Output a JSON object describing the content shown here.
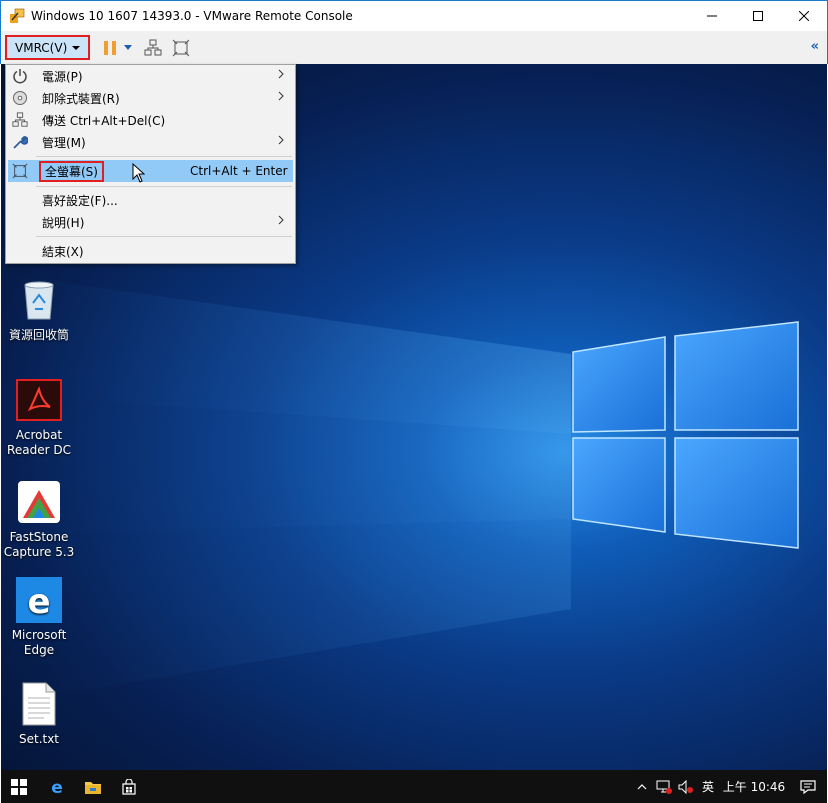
{
  "window": {
    "title": "Windows 10 1607 14393.0 - VMware Remote Console",
    "minimize_glyph": "—",
    "maximize_glyph": "☐",
    "close_glyph": "✕"
  },
  "toolbar": {
    "vmrc_label": "VMRC(V)",
    "collapse_glyph": "«"
  },
  "menu": {
    "items": [
      {
        "label": "電源(P)",
        "icon": "power-icon",
        "submenu": true
      },
      {
        "label": "卸除式裝置(R)",
        "icon": "disc-icon",
        "submenu": true
      },
      {
        "label": "傳送 Ctrl+Alt+Del(C)",
        "icon": "network-icon",
        "submenu": false
      },
      {
        "label": "管理(M)",
        "icon": "wrench-icon",
        "submenu": true
      },
      {
        "label": "全螢幕(S)",
        "icon": "fullscreen-icon",
        "shortcut": "Ctrl+Alt + Enter",
        "highlighted": true
      },
      {
        "label": "喜好設定(F)...",
        "submenu": false
      },
      {
        "label": "說明(H)",
        "submenu": true
      },
      {
        "label": "結束(X)",
        "submenu": false
      }
    ]
  },
  "desktop": {
    "icons": [
      {
        "label": "資源回收筒",
        "icon": "recycle-bin-icon"
      },
      {
        "label": "Acrobat Reader DC",
        "icon": "acrobat-icon"
      },
      {
        "label": "FastStone Capture 5.3",
        "icon": "faststone-icon"
      },
      {
        "label": "Microsoft Edge",
        "icon": "edge-icon"
      },
      {
        "label": "Set.txt",
        "icon": "text-file-icon"
      }
    ]
  },
  "taskbar": {
    "ime": "英",
    "clock": "上午 10:46",
    "chevron_glyph": "^"
  },
  "colors": {
    "accent": "#1979ca",
    "highlight_red": "#e02020",
    "menu_hover": "#91c9f7"
  }
}
